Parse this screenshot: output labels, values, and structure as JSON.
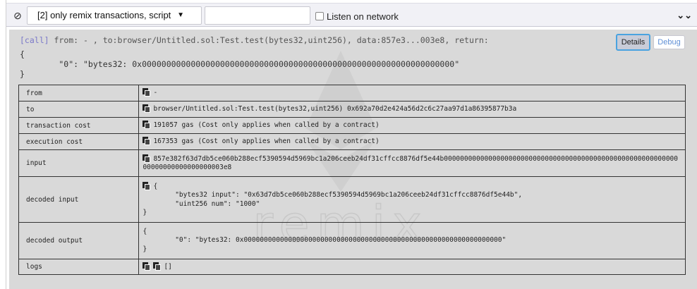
{
  "toolbar": {
    "filter_selected": "[2] only remix transactions, script",
    "search_placeholder": "",
    "listen_label": "Listen on network",
    "clear_icon": "ban-icon",
    "collapse_icon": "double-chevron-down-icon"
  },
  "tx": {
    "tag": "[call]",
    "summary": " from: - , to:browser/Untitled.sol:Test.test(bytes32,uint256), data:857e3...003e8, return:",
    "return_open": "{",
    "return_body": "        \"0\": \"bytes32: 0x0000000000000000000000000000000000000000000000000000000000000000\"",
    "return_close": "}",
    "details_label": "Details",
    "debug_label": "Debug",
    "watermark_text": "remix",
    "rows": [
      {
        "key": "from",
        "value": "-"
      },
      {
        "key": "to",
        "value": "browser/Untitled.sol:Test.test(bytes32,uint256) 0x692a70d2e424a56d2c6c27aa97d1a86395877b3a"
      },
      {
        "key": "transaction cost",
        "value": "191057 gas (Cost only applies when called by a contract)"
      },
      {
        "key": "execution cost",
        "value": "167353 gas (Cost only applies when called by a contract)"
      },
      {
        "key": "input",
        "value": "857e382f63d7db5ce060b288ecf5390594d5969bc1a206ceeb24df31cffcc8876df5e44b0000000000000000000000000000000000000000000000000000000000\n00000000000000000003e8"
      },
      {
        "key": "decoded input",
        "value": "{\n        \"bytes32 input\": \"0x63d7db5ce060b288ecf5390594d5969bc1a206ceeb24df31cffcc8876df5e44b\",\n        \"uint256 num\": \"1000\"\n}"
      },
      {
        "key": "decoded output",
        "value": "{\n        \"0\": \"bytes32: 0x0000000000000000000000000000000000000000000000000000000000000000\"\n}"
      },
      {
        "key": "logs",
        "value": "[]"
      }
    ]
  }
}
